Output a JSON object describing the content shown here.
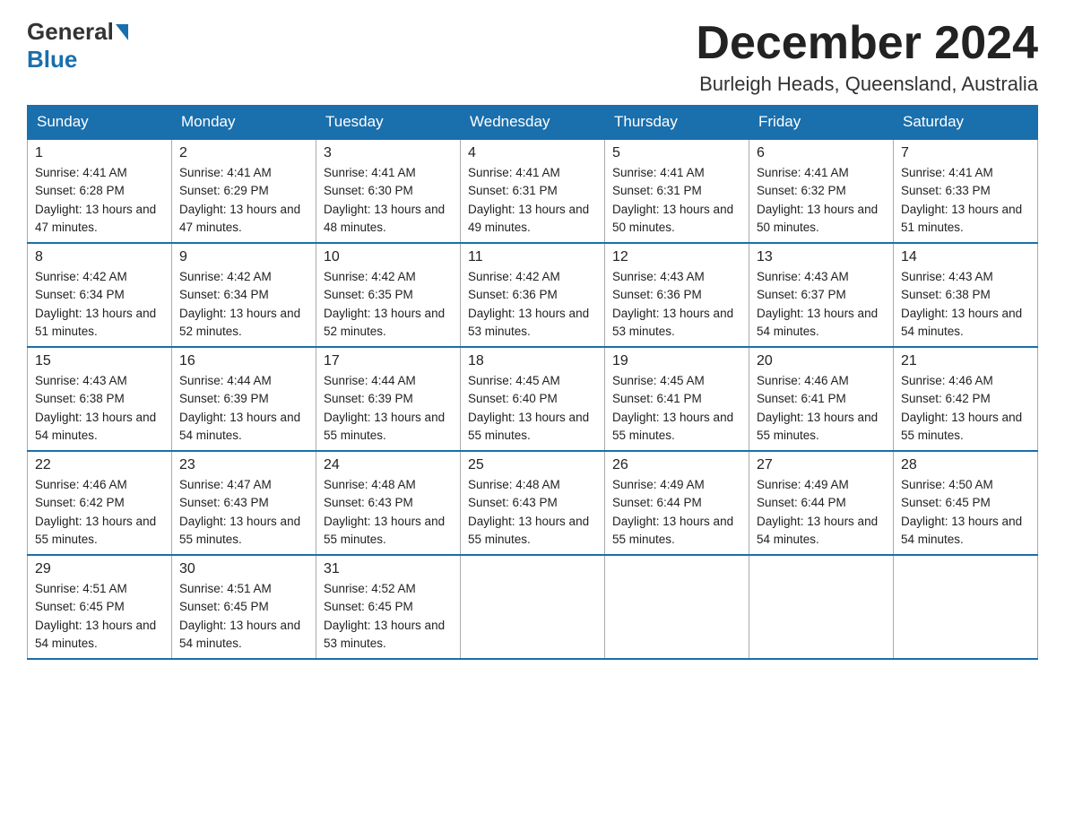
{
  "header": {
    "logo_general": "General",
    "logo_blue": "Blue",
    "month_title": "December 2024",
    "location": "Burleigh Heads, Queensland, Australia"
  },
  "weekdays": [
    "Sunday",
    "Monday",
    "Tuesday",
    "Wednesday",
    "Thursday",
    "Friday",
    "Saturday"
  ],
  "weeks": [
    [
      {
        "day": "1",
        "sunrise": "4:41 AM",
        "sunset": "6:28 PM",
        "daylight": "13 hours and 47 minutes."
      },
      {
        "day": "2",
        "sunrise": "4:41 AM",
        "sunset": "6:29 PM",
        "daylight": "13 hours and 47 minutes."
      },
      {
        "day": "3",
        "sunrise": "4:41 AM",
        "sunset": "6:30 PM",
        "daylight": "13 hours and 48 minutes."
      },
      {
        "day": "4",
        "sunrise": "4:41 AM",
        "sunset": "6:31 PM",
        "daylight": "13 hours and 49 minutes."
      },
      {
        "day": "5",
        "sunrise": "4:41 AM",
        "sunset": "6:31 PM",
        "daylight": "13 hours and 50 minutes."
      },
      {
        "day": "6",
        "sunrise": "4:41 AM",
        "sunset": "6:32 PM",
        "daylight": "13 hours and 50 minutes."
      },
      {
        "day": "7",
        "sunrise": "4:41 AM",
        "sunset": "6:33 PM",
        "daylight": "13 hours and 51 minutes."
      }
    ],
    [
      {
        "day": "8",
        "sunrise": "4:42 AM",
        "sunset": "6:34 PM",
        "daylight": "13 hours and 51 minutes."
      },
      {
        "day": "9",
        "sunrise": "4:42 AM",
        "sunset": "6:34 PM",
        "daylight": "13 hours and 52 minutes."
      },
      {
        "day": "10",
        "sunrise": "4:42 AM",
        "sunset": "6:35 PM",
        "daylight": "13 hours and 52 minutes."
      },
      {
        "day": "11",
        "sunrise": "4:42 AM",
        "sunset": "6:36 PM",
        "daylight": "13 hours and 53 minutes."
      },
      {
        "day": "12",
        "sunrise": "4:43 AM",
        "sunset": "6:36 PM",
        "daylight": "13 hours and 53 minutes."
      },
      {
        "day": "13",
        "sunrise": "4:43 AM",
        "sunset": "6:37 PM",
        "daylight": "13 hours and 54 minutes."
      },
      {
        "day": "14",
        "sunrise": "4:43 AM",
        "sunset": "6:38 PM",
        "daylight": "13 hours and 54 minutes."
      }
    ],
    [
      {
        "day": "15",
        "sunrise": "4:43 AM",
        "sunset": "6:38 PM",
        "daylight": "13 hours and 54 minutes."
      },
      {
        "day": "16",
        "sunrise": "4:44 AM",
        "sunset": "6:39 PM",
        "daylight": "13 hours and 54 minutes."
      },
      {
        "day": "17",
        "sunrise": "4:44 AM",
        "sunset": "6:39 PM",
        "daylight": "13 hours and 55 minutes."
      },
      {
        "day": "18",
        "sunrise": "4:45 AM",
        "sunset": "6:40 PM",
        "daylight": "13 hours and 55 minutes."
      },
      {
        "day": "19",
        "sunrise": "4:45 AM",
        "sunset": "6:41 PM",
        "daylight": "13 hours and 55 minutes."
      },
      {
        "day": "20",
        "sunrise": "4:46 AM",
        "sunset": "6:41 PM",
        "daylight": "13 hours and 55 minutes."
      },
      {
        "day": "21",
        "sunrise": "4:46 AM",
        "sunset": "6:42 PM",
        "daylight": "13 hours and 55 minutes."
      }
    ],
    [
      {
        "day": "22",
        "sunrise": "4:46 AM",
        "sunset": "6:42 PM",
        "daylight": "13 hours and 55 minutes."
      },
      {
        "day": "23",
        "sunrise": "4:47 AM",
        "sunset": "6:43 PM",
        "daylight": "13 hours and 55 minutes."
      },
      {
        "day": "24",
        "sunrise": "4:48 AM",
        "sunset": "6:43 PM",
        "daylight": "13 hours and 55 minutes."
      },
      {
        "day": "25",
        "sunrise": "4:48 AM",
        "sunset": "6:43 PM",
        "daylight": "13 hours and 55 minutes."
      },
      {
        "day": "26",
        "sunrise": "4:49 AM",
        "sunset": "6:44 PM",
        "daylight": "13 hours and 55 minutes."
      },
      {
        "day": "27",
        "sunrise": "4:49 AM",
        "sunset": "6:44 PM",
        "daylight": "13 hours and 54 minutes."
      },
      {
        "day": "28",
        "sunrise": "4:50 AM",
        "sunset": "6:45 PM",
        "daylight": "13 hours and 54 minutes."
      }
    ],
    [
      {
        "day": "29",
        "sunrise": "4:51 AM",
        "sunset": "6:45 PM",
        "daylight": "13 hours and 54 minutes."
      },
      {
        "day": "30",
        "sunrise": "4:51 AM",
        "sunset": "6:45 PM",
        "daylight": "13 hours and 54 minutes."
      },
      {
        "day": "31",
        "sunrise": "4:52 AM",
        "sunset": "6:45 PM",
        "daylight": "13 hours and 53 minutes."
      },
      null,
      null,
      null,
      null
    ]
  ]
}
